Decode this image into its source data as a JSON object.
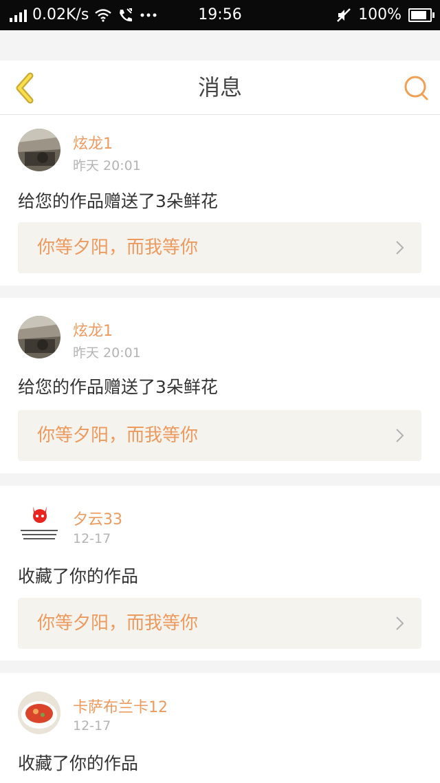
{
  "status_bar": {
    "speed": "0.02K/s",
    "time": "19:56",
    "battery": "100%",
    "battery_level": 1.0,
    "icons": [
      "signal-icon",
      "wifi-icon",
      "phone-icon",
      "more-icon",
      "mute-icon",
      "battery-icon"
    ]
  },
  "header": {
    "title": "消息",
    "back_icon": "back-chevron-icon",
    "search_icon": "search-icon",
    "accent": "#f0a052"
  },
  "messages": [
    {
      "user": "炫龙1",
      "time": "昨天 20:01",
      "action": "给您的作品赠送了3朵鲜花",
      "work": "你等夕阳，而我等你"
    },
    {
      "user": "炫龙1",
      "time": "昨天 20:01",
      "action": "给您的作品赠送了3朵鲜花",
      "work": "你等夕阳，而我等你"
    },
    {
      "user": "夕云33",
      "time": "12-17",
      "action": "收藏了你的作品",
      "work": "你等夕阳，而我等你"
    },
    {
      "user": "卡萨布兰卡12",
      "time": "12-17",
      "action": "收藏了你的作品",
      "work": ""
    }
  ],
  "colors": {
    "username": "#ec9a5e",
    "work_link_bg": "#f5f3ee",
    "page_bg": "#f4f4f4"
  }
}
